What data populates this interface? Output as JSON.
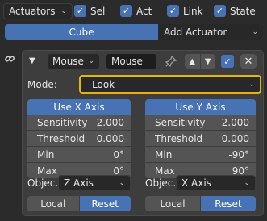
{
  "header": {
    "actuators_dropdown": "Actuators",
    "filters": [
      {
        "label": "Sel",
        "checked": true
      },
      {
        "label": "Act",
        "checked": true
      },
      {
        "label": "Link",
        "checked": true
      },
      {
        "label": "State",
        "checked": true
      }
    ]
  },
  "tabs": {
    "object_name": "Cube",
    "add_label": "Add Actuator"
  },
  "actuator": {
    "type": "Mouse",
    "name": "Mouse",
    "mode_label": "Mode:",
    "mode_value": "Look",
    "x_axis": {
      "title": "Use X Axis",
      "sensitivity_label": "Sensitivity",
      "sensitivity": "2.000",
      "threshold_label": "Threshold",
      "threshold": "0.000",
      "min_label": "Min",
      "min": "0°",
      "max_label": "Max",
      "max": "0°",
      "object_label": "Objec...",
      "object_value": "Z Axis",
      "local_label": "Local",
      "reset_label": "Reset"
    },
    "y_axis": {
      "title": "Use Y Axis",
      "sensitivity_label": "Sensitivity",
      "sensitivity": "2.000",
      "threshold_label": "Threshold",
      "threshold": "0.000",
      "min_label": "Min",
      "min": "-90°",
      "max_label": "Max",
      "max": "90°",
      "object_label": "Objec...",
      "object_value": "X Axis",
      "local_label": "Local",
      "reset_label": "Reset"
    }
  },
  "colors": {
    "accent": "#4772b3",
    "focus_outline": "#e5b50f",
    "background": "#2b2b2b"
  }
}
